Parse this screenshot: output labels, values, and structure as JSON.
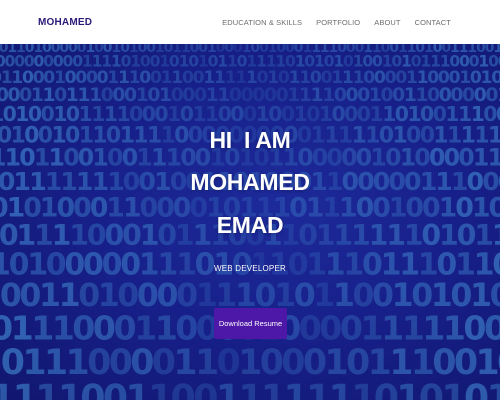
{
  "navbar": {
    "brand": "MOHAMED",
    "links": [
      "EDUCATION & SKILLS",
      "PORTFOLIO",
      "ABOUT",
      "CONTACT"
    ]
  },
  "hero": {
    "title_lines": [
      "HI  I AM",
      "MOHAMED",
      "EMAD"
    ],
    "subtitle": "WEB DEVELOPER",
    "cta_label": "Download Resume",
    "background_image": "binary-code-pattern"
  },
  "colors": {
    "brand": "#2c1a78",
    "nav_text": "#6d6d6d",
    "hero_bg": "#1a2390",
    "cta_bg": "#4d18a8",
    "binary_digits": "#4fa8e8"
  }
}
